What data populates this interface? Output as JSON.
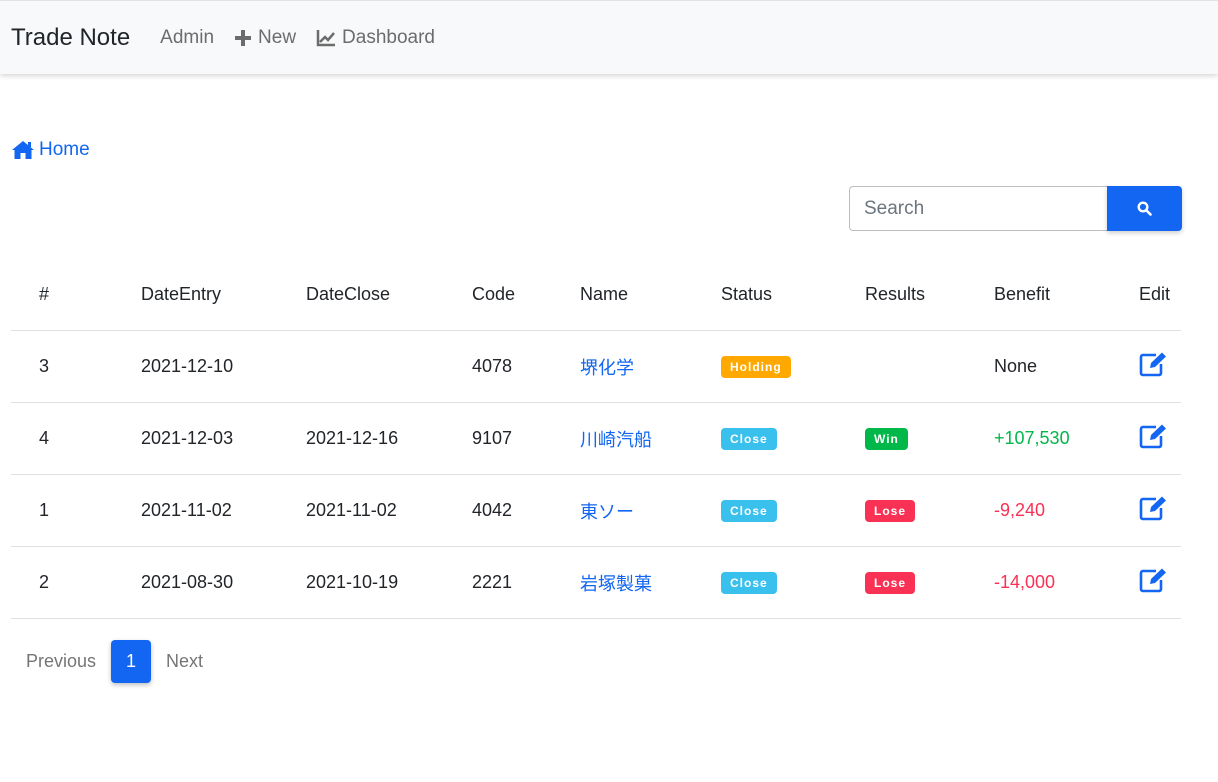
{
  "navbar": {
    "brand": "Trade Note",
    "links": [
      {
        "label": "Admin",
        "icon": ""
      },
      {
        "label": "New",
        "icon": "plus-icon"
      },
      {
        "label": "Dashboard",
        "icon": "chart-line-icon"
      }
    ]
  },
  "breadcrumb": {
    "label": "Home",
    "icon": "home-icon"
  },
  "search": {
    "placeholder": "Search",
    "value": "",
    "button_icon": "search-icon"
  },
  "table": {
    "headers": [
      "#",
      "DateEntry",
      "DateClose",
      "Code",
      "Name",
      "Status",
      "Results",
      "Benefit",
      "Edit"
    ],
    "rows": [
      {
        "id": "3",
        "date_entry": "2021-12-10",
        "date_close": "",
        "code": "4078",
        "name": "堺化学",
        "status": "Holding",
        "result": "",
        "benefit": "None"
      },
      {
        "id": "4",
        "date_entry": "2021-12-03",
        "date_close": "2021-12-16",
        "code": "9107",
        "name": "川崎汽船",
        "status": "Close",
        "result": "Win",
        "benefit": "+107,530"
      },
      {
        "id": "1",
        "date_entry": "2021-11-02",
        "date_close": "2021-11-02",
        "code": "4042",
        "name": "東ソー",
        "status": "Close",
        "result": "Lose",
        "benefit": "-9,240"
      },
      {
        "id": "2",
        "date_entry": "2021-08-30",
        "date_close": "2021-10-19",
        "code": "2221",
        "name": "岩塚製菓",
        "status": "Close",
        "result": "Lose",
        "benefit": "-14,000"
      }
    ]
  },
  "pagination": {
    "previous": "Previous",
    "current": "1",
    "next": "Next"
  },
  "colors": {
    "primary": "#1266f1",
    "holding": "#ffa900",
    "close": "#39c0ed",
    "win": "#00b74a",
    "lose": "#f93154"
  }
}
